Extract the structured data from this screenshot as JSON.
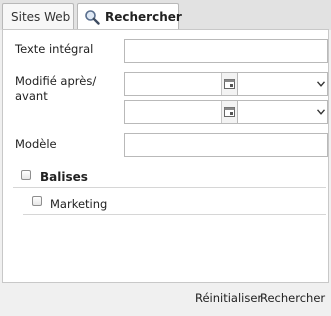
{
  "tabs": [
    {
      "label": "Sites Web"
    },
    {
      "label": "Rechercher"
    }
  ],
  "form": {
    "fulltext_label": "Texte intégral",
    "fulltext_value": "",
    "modified_label_line1": "Modifié après/",
    "modified_label_line2": "avant",
    "after_date": "",
    "after_time": "",
    "before_date": "",
    "before_time": "",
    "template_label": "Modèle",
    "template_value": "",
    "tags_label": "Balises",
    "tag_items": [
      {
        "label": "Marketing"
      }
    ]
  },
  "footer": {
    "reset_label": "Réinitialiser",
    "search_label": "Rechercher"
  },
  "colors": {
    "panel_bg": "#ffffff",
    "window_bg": "#f0f0f0",
    "border": "#b9b9b9"
  },
  "icons": [
    "search-icon",
    "calendar-icon",
    "chevron-down-icon"
  ]
}
